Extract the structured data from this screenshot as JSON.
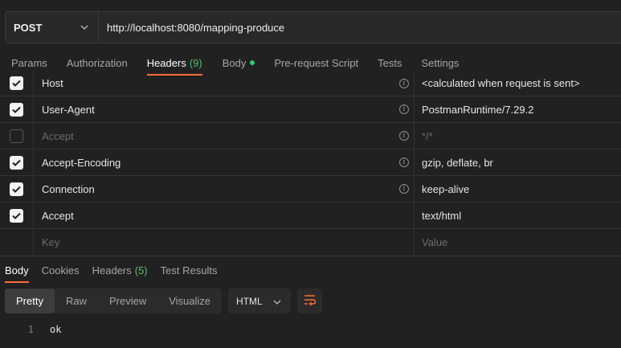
{
  "request": {
    "method": "POST",
    "url": "http://localhost:8080/mapping-produce"
  },
  "request_tabs": [
    {
      "label": "Params"
    },
    {
      "label": "Authorization"
    },
    {
      "label": "Headers",
      "count": "(9)",
      "active": true
    },
    {
      "label": "Body",
      "has_dot": true
    },
    {
      "label": "Pre-request Script"
    },
    {
      "label": "Tests"
    },
    {
      "label": "Settings"
    }
  ],
  "headers": [
    {
      "checked": true,
      "key": "Host",
      "value": "<calculated when request is sent>",
      "info": true
    },
    {
      "checked": true,
      "key": "User-Agent",
      "value": "PostmanRuntime/7.29.2",
      "info": true
    },
    {
      "checked": false,
      "key": "Accept",
      "value": "*/*",
      "info": true
    },
    {
      "checked": true,
      "key": "Accept-Encoding",
      "value": "gzip, deflate, br",
      "info": true
    },
    {
      "checked": true,
      "key": "Connection",
      "value": "keep-alive",
      "info": true
    },
    {
      "checked": true,
      "key": "Accept",
      "value": "text/html",
      "info": false
    }
  ],
  "new_row": {
    "key_placeholder": "Key",
    "value_placeholder": "Value"
  },
  "response_tabs": [
    {
      "label": "Body",
      "active": true
    },
    {
      "label": "Cookies"
    },
    {
      "label": "Headers",
      "count": "(5)"
    },
    {
      "label": "Test Results"
    }
  ],
  "view_modes": [
    "Pretty",
    "Raw",
    "Preview",
    "Visualize"
  ],
  "active_view_mode": "Pretty",
  "format": "HTML",
  "body_lines": [
    {
      "number": "1",
      "text": "ok"
    }
  ],
  "colors": {
    "accent": "#ff6c37",
    "count_green": "#5cbf6c",
    "dot_green": "#2ecc71"
  },
  "icons": {
    "method_dropdown": "chevron-down-icon",
    "info": "info-icon",
    "wrap": "wrap-lines-icon",
    "format_dropdown": "chevron-down-icon"
  }
}
